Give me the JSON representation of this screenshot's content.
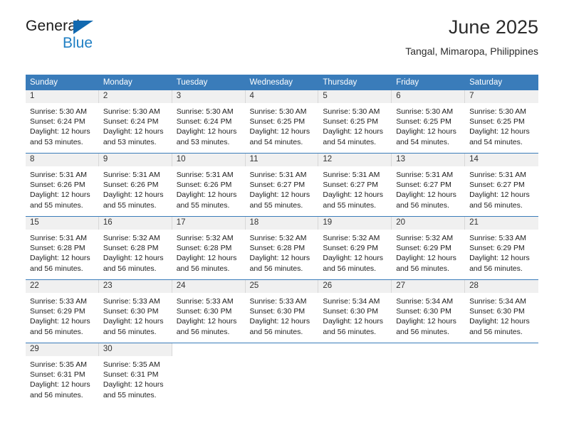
{
  "brand": {
    "name_top": "General",
    "name_bottom": "Blue",
    "triangle_color": "#1269b0",
    "blue_text_color": "#1f7fc4"
  },
  "header": {
    "title": "June 2025",
    "location": "Tangal, Mimaropa, Philippines"
  },
  "theme": {
    "header_row_bg": "#3a7cba",
    "header_row_text": "#ffffff",
    "daynum_band_bg": "#f0f0f0",
    "row_divider": "#3a7cba",
    "page_bg": "#ffffff"
  },
  "calendar": {
    "weekday_headers": [
      "Sunday",
      "Monday",
      "Tuesday",
      "Wednesday",
      "Thursday",
      "Friday",
      "Saturday"
    ],
    "weeks": [
      [
        {
          "day": "1",
          "sunrise": "Sunrise: 5:30 AM",
          "sunset": "Sunset: 6:24 PM",
          "daylight_line1": "Daylight: 12 hours",
          "daylight_line2": "and 53 minutes."
        },
        {
          "day": "2",
          "sunrise": "Sunrise: 5:30 AM",
          "sunset": "Sunset: 6:24 PM",
          "daylight_line1": "Daylight: 12 hours",
          "daylight_line2": "and 53 minutes."
        },
        {
          "day": "3",
          "sunrise": "Sunrise: 5:30 AM",
          "sunset": "Sunset: 6:24 PM",
          "daylight_line1": "Daylight: 12 hours",
          "daylight_line2": "and 53 minutes."
        },
        {
          "day": "4",
          "sunrise": "Sunrise: 5:30 AM",
          "sunset": "Sunset: 6:25 PM",
          "daylight_line1": "Daylight: 12 hours",
          "daylight_line2": "and 54 minutes."
        },
        {
          "day": "5",
          "sunrise": "Sunrise: 5:30 AM",
          "sunset": "Sunset: 6:25 PM",
          "daylight_line1": "Daylight: 12 hours",
          "daylight_line2": "and 54 minutes."
        },
        {
          "day": "6",
          "sunrise": "Sunrise: 5:30 AM",
          "sunset": "Sunset: 6:25 PM",
          "daylight_line1": "Daylight: 12 hours",
          "daylight_line2": "and 54 minutes."
        },
        {
          "day": "7",
          "sunrise": "Sunrise: 5:30 AM",
          "sunset": "Sunset: 6:25 PM",
          "daylight_line1": "Daylight: 12 hours",
          "daylight_line2": "and 54 minutes."
        }
      ],
      [
        {
          "day": "8",
          "sunrise": "Sunrise: 5:31 AM",
          "sunset": "Sunset: 6:26 PM",
          "daylight_line1": "Daylight: 12 hours",
          "daylight_line2": "and 55 minutes."
        },
        {
          "day": "9",
          "sunrise": "Sunrise: 5:31 AM",
          "sunset": "Sunset: 6:26 PM",
          "daylight_line1": "Daylight: 12 hours",
          "daylight_line2": "and 55 minutes."
        },
        {
          "day": "10",
          "sunrise": "Sunrise: 5:31 AM",
          "sunset": "Sunset: 6:26 PM",
          "daylight_line1": "Daylight: 12 hours",
          "daylight_line2": "and 55 minutes."
        },
        {
          "day": "11",
          "sunrise": "Sunrise: 5:31 AM",
          "sunset": "Sunset: 6:27 PM",
          "daylight_line1": "Daylight: 12 hours",
          "daylight_line2": "and 55 minutes."
        },
        {
          "day": "12",
          "sunrise": "Sunrise: 5:31 AM",
          "sunset": "Sunset: 6:27 PM",
          "daylight_line1": "Daylight: 12 hours",
          "daylight_line2": "and 55 minutes."
        },
        {
          "day": "13",
          "sunrise": "Sunrise: 5:31 AM",
          "sunset": "Sunset: 6:27 PM",
          "daylight_line1": "Daylight: 12 hours",
          "daylight_line2": "and 56 minutes."
        },
        {
          "day": "14",
          "sunrise": "Sunrise: 5:31 AM",
          "sunset": "Sunset: 6:27 PM",
          "daylight_line1": "Daylight: 12 hours",
          "daylight_line2": "and 56 minutes."
        }
      ],
      [
        {
          "day": "15",
          "sunrise": "Sunrise: 5:31 AM",
          "sunset": "Sunset: 6:28 PM",
          "daylight_line1": "Daylight: 12 hours",
          "daylight_line2": "and 56 minutes."
        },
        {
          "day": "16",
          "sunrise": "Sunrise: 5:32 AM",
          "sunset": "Sunset: 6:28 PM",
          "daylight_line1": "Daylight: 12 hours",
          "daylight_line2": "and 56 minutes."
        },
        {
          "day": "17",
          "sunrise": "Sunrise: 5:32 AM",
          "sunset": "Sunset: 6:28 PM",
          "daylight_line1": "Daylight: 12 hours",
          "daylight_line2": "and 56 minutes."
        },
        {
          "day": "18",
          "sunrise": "Sunrise: 5:32 AM",
          "sunset": "Sunset: 6:28 PM",
          "daylight_line1": "Daylight: 12 hours",
          "daylight_line2": "and 56 minutes."
        },
        {
          "day": "19",
          "sunrise": "Sunrise: 5:32 AM",
          "sunset": "Sunset: 6:29 PM",
          "daylight_line1": "Daylight: 12 hours",
          "daylight_line2": "and 56 minutes."
        },
        {
          "day": "20",
          "sunrise": "Sunrise: 5:32 AM",
          "sunset": "Sunset: 6:29 PM",
          "daylight_line1": "Daylight: 12 hours",
          "daylight_line2": "and 56 minutes."
        },
        {
          "day": "21",
          "sunrise": "Sunrise: 5:33 AM",
          "sunset": "Sunset: 6:29 PM",
          "daylight_line1": "Daylight: 12 hours",
          "daylight_line2": "and 56 minutes."
        }
      ],
      [
        {
          "day": "22",
          "sunrise": "Sunrise: 5:33 AM",
          "sunset": "Sunset: 6:29 PM",
          "daylight_line1": "Daylight: 12 hours",
          "daylight_line2": "and 56 minutes."
        },
        {
          "day": "23",
          "sunrise": "Sunrise: 5:33 AM",
          "sunset": "Sunset: 6:30 PM",
          "daylight_line1": "Daylight: 12 hours",
          "daylight_line2": "and 56 minutes."
        },
        {
          "day": "24",
          "sunrise": "Sunrise: 5:33 AM",
          "sunset": "Sunset: 6:30 PM",
          "daylight_line1": "Daylight: 12 hours",
          "daylight_line2": "and 56 minutes."
        },
        {
          "day": "25",
          "sunrise": "Sunrise: 5:33 AM",
          "sunset": "Sunset: 6:30 PM",
          "daylight_line1": "Daylight: 12 hours",
          "daylight_line2": "and 56 minutes."
        },
        {
          "day": "26",
          "sunrise": "Sunrise: 5:34 AM",
          "sunset": "Sunset: 6:30 PM",
          "daylight_line1": "Daylight: 12 hours",
          "daylight_line2": "and 56 minutes."
        },
        {
          "day": "27",
          "sunrise": "Sunrise: 5:34 AM",
          "sunset": "Sunset: 6:30 PM",
          "daylight_line1": "Daylight: 12 hours",
          "daylight_line2": "and 56 minutes."
        },
        {
          "day": "28",
          "sunrise": "Sunrise: 5:34 AM",
          "sunset": "Sunset: 6:30 PM",
          "daylight_line1": "Daylight: 12 hours",
          "daylight_line2": "and 56 minutes."
        }
      ],
      [
        {
          "day": "29",
          "sunrise": "Sunrise: 5:35 AM",
          "sunset": "Sunset: 6:31 PM",
          "daylight_line1": "Daylight: 12 hours",
          "daylight_line2": "and 56 minutes."
        },
        {
          "day": "30",
          "sunrise": "Sunrise: 5:35 AM",
          "sunset": "Sunset: 6:31 PM",
          "daylight_line1": "Daylight: 12 hours",
          "daylight_line2": "and 55 minutes."
        },
        {
          "day": "",
          "sunrise": "",
          "sunset": "",
          "daylight_line1": "",
          "daylight_line2": ""
        },
        {
          "day": "",
          "sunrise": "",
          "sunset": "",
          "daylight_line1": "",
          "daylight_line2": ""
        },
        {
          "day": "",
          "sunrise": "",
          "sunset": "",
          "daylight_line1": "",
          "daylight_line2": ""
        },
        {
          "day": "",
          "sunrise": "",
          "sunset": "",
          "daylight_line1": "",
          "daylight_line2": ""
        },
        {
          "day": "",
          "sunrise": "",
          "sunset": "",
          "daylight_line1": "",
          "daylight_line2": ""
        }
      ]
    ]
  }
}
